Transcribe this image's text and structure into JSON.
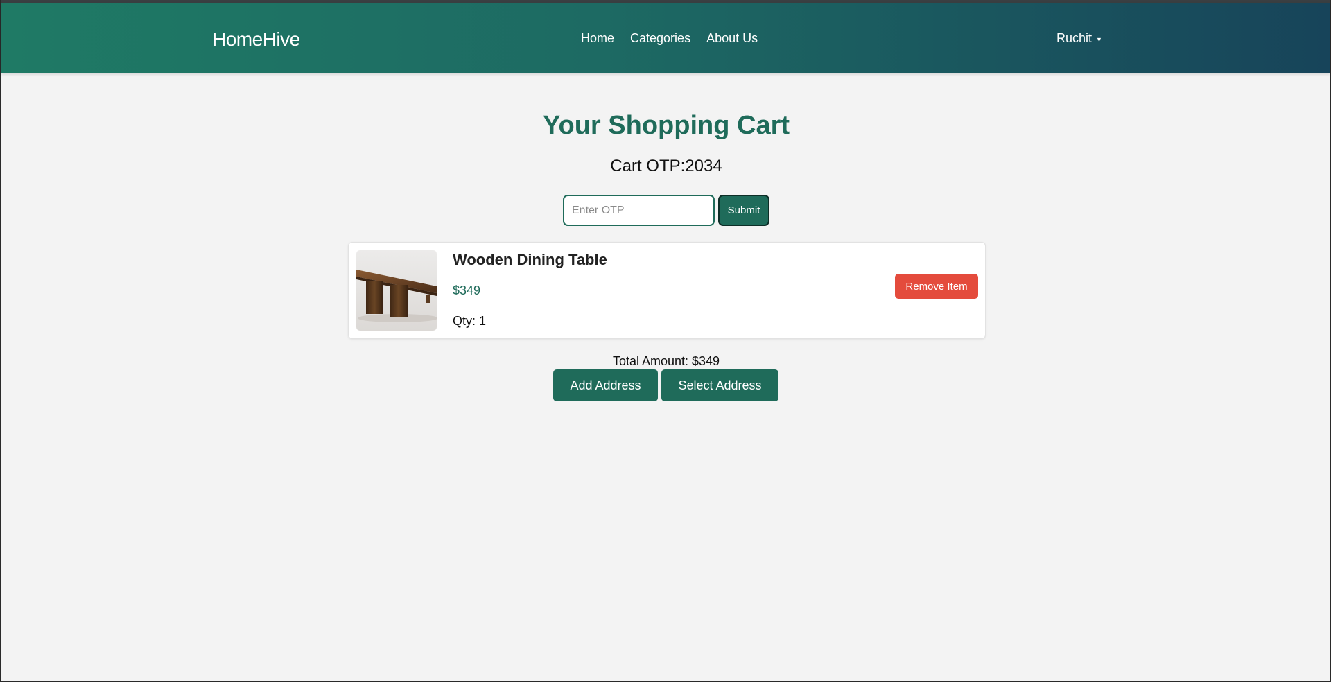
{
  "header": {
    "brand": "HomeHive",
    "nav": [
      {
        "label": "Home"
      },
      {
        "label": "Categories"
      },
      {
        "label": "About Us"
      }
    ],
    "user": {
      "name": "Ruchit",
      "menu_icon": "caret-down-icon"
    }
  },
  "cart": {
    "title": "Your Shopping Cart",
    "otp_label": "Cart OTP:2034",
    "otp_input": {
      "placeholder": "Enter OTP",
      "value": ""
    },
    "submit_label": "Submit",
    "items": [
      {
        "name": "Wooden Dining Table",
        "price": "$349",
        "qty_label": "Qty: 1",
        "remove_label": "Remove Item",
        "image": "wooden-table-photo"
      }
    ],
    "total_label": "Total Amount: $349",
    "add_address_label": "Add Address",
    "select_address_label": "Select Address"
  },
  "colors": {
    "brand_green": "#1f6b5a",
    "header_gradient_start": "#1f7a65",
    "header_gradient_end": "#17445a",
    "remove_red": "#e44b3c",
    "page_background": "#f3f3f3"
  }
}
